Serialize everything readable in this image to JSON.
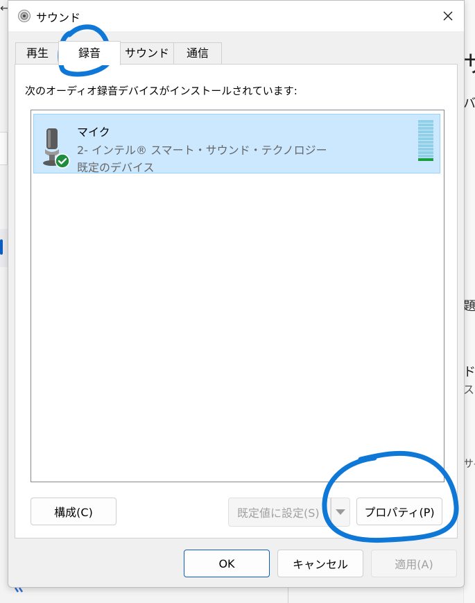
{
  "background": {
    "frag_title": "サ",
    "frag_1": "バ",
    "frag_2": "題",
    "frag_3": "ド",
    "frag_4": "ス",
    "frag_5": "サ-"
  },
  "dialog": {
    "title": "サウンド",
    "tabs": [
      {
        "label": "再生",
        "active": false
      },
      {
        "label": "録音",
        "active": true
      },
      {
        "label": "サウンド",
        "active": false
      },
      {
        "label": "通信",
        "active": false
      }
    ],
    "instruction": "次のオーディオ録音デバイスがインストールされています:",
    "devices": [
      {
        "name": "マイク",
        "description": "2- インテル® スマート・サウンド・テクノロジー",
        "status": "既定のデバイス",
        "selected": true,
        "level_fraction": 0.08
      }
    ],
    "buttons": {
      "configure": "構成(C)",
      "set_default": "既定値に設定(S)",
      "properties": "プロパティ(P)",
      "ok": "OK",
      "cancel": "キャンセル",
      "apply": "適用(A)"
    }
  },
  "colors": {
    "accent": "#0a5cc1",
    "selection": "#cce8ff",
    "annotation": "#0f78d7",
    "default_check": "#1e8e3e"
  },
  "icons": {
    "title": "speaker-icon",
    "close": "close-icon",
    "device": "microphone-icon",
    "status": "check-circle-icon",
    "dropdown": "chevron-down-icon"
  }
}
